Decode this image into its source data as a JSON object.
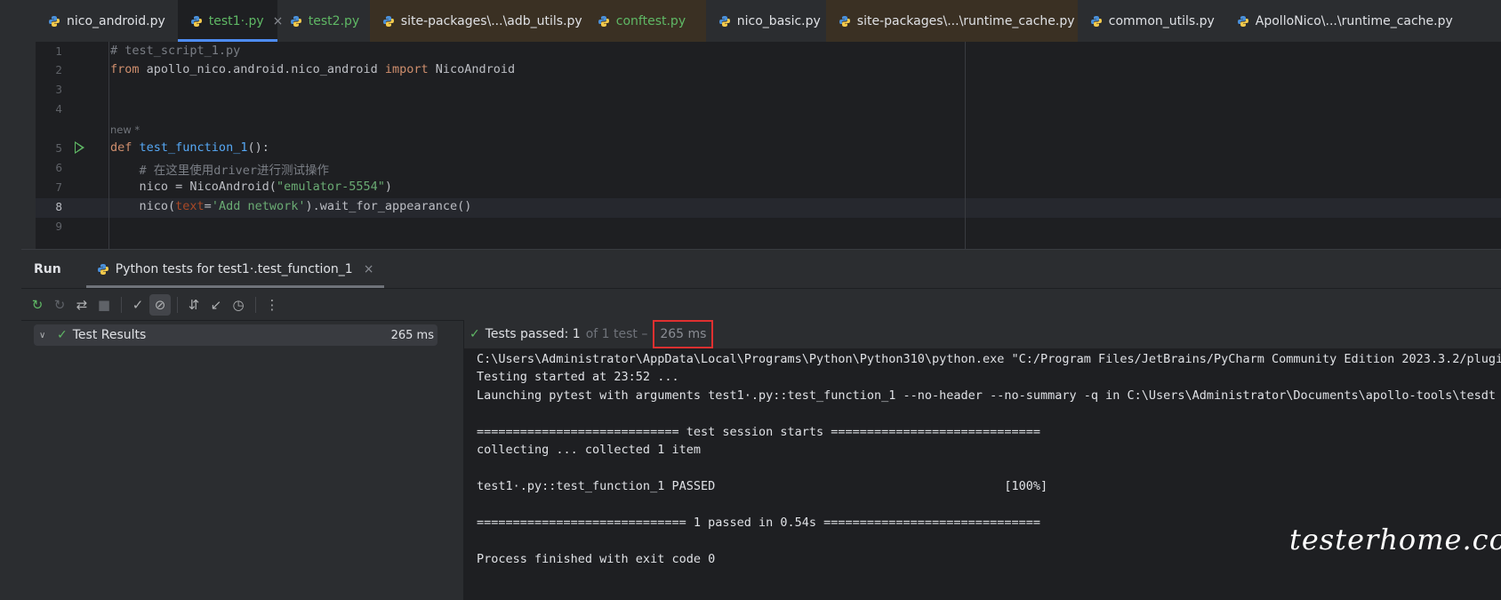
{
  "tabs": [
    {
      "label": "nico_android.py",
      "style": "normal"
    },
    {
      "label": "test1·.py",
      "style": "green",
      "active": true
    },
    {
      "label": "test2.py",
      "style": "green"
    },
    {
      "label": "site-packages\\...\\adb_utils.py",
      "style": "brown"
    },
    {
      "label": "conftest.py",
      "style": "green-brown"
    },
    {
      "label": "nico_basic.py",
      "style": "normal"
    },
    {
      "label": "site-packages\\...\\runtime_cache.py",
      "style": "brown"
    },
    {
      "label": "common_utils.py",
      "style": "normal"
    },
    {
      "label": "ApolloNico\\...\\runtime_cache.py",
      "style": "normal"
    }
  ],
  "tab_close_glyph": "×",
  "editor": {
    "line_numbers": [
      "1",
      "2",
      "3",
      "4",
      "5",
      "6",
      "7",
      "8",
      "9"
    ],
    "hint_new": "new *",
    "line1": "# test_script_1.py",
    "line2": {
      "kw1": "from",
      "mod": " apollo_nico.android.nico_android ",
      "kw2": "import",
      "name": " NicoAndroid"
    },
    "line5": {
      "kw": "def",
      "fn": "test_function_1",
      "rest": "():"
    },
    "line6": "    # 在这里使用driver进行测试操作",
    "line7": {
      "pre": "    nico = NicoAndroid(",
      "str": "\"emulator-5554\"",
      "post": ")"
    },
    "line8": {
      "pre": "    nico(",
      "param": "text",
      "eq": "=",
      "str": "'Add network'",
      "post": ").wait_for_appearance()"
    }
  },
  "run": {
    "title": "Run",
    "tab_label": "Python tests for test1·.test_function_1",
    "results_label": "Test Results",
    "results_time": "265 ms",
    "status_label": "Tests passed: 1",
    "status_sub": "of 1 test –",
    "status_time": "265 ms"
  },
  "console_lines": [
    "C:\\Users\\Administrator\\AppData\\Local\\Programs\\Python\\Python310\\python.exe \"C:/Program Files/JetBrains/PyCharm Community Edition 2023.3.2/plugins/",
    "Testing started at 23:52 ...",
    "Launching pytest with arguments test1·.py::test_function_1 --no-header --no-summary -q in C:\\Users\\Administrator\\Documents\\apollo-tools\\tesdt",
    "",
    "============================ test session starts =============================",
    "collecting ... collected 1 item",
    "",
    "test1·.py::test_function_1 PASSED                                        [100%]",
    "",
    "============================= 1 passed in 0.54s ==============================",
    "",
    "Process finished with exit code 0"
  ],
  "watermark": "testerhome.com",
  "colors": {
    "accent": "#4e8cf4",
    "success": "#5fb865",
    "highlight_box": "#e03030"
  }
}
